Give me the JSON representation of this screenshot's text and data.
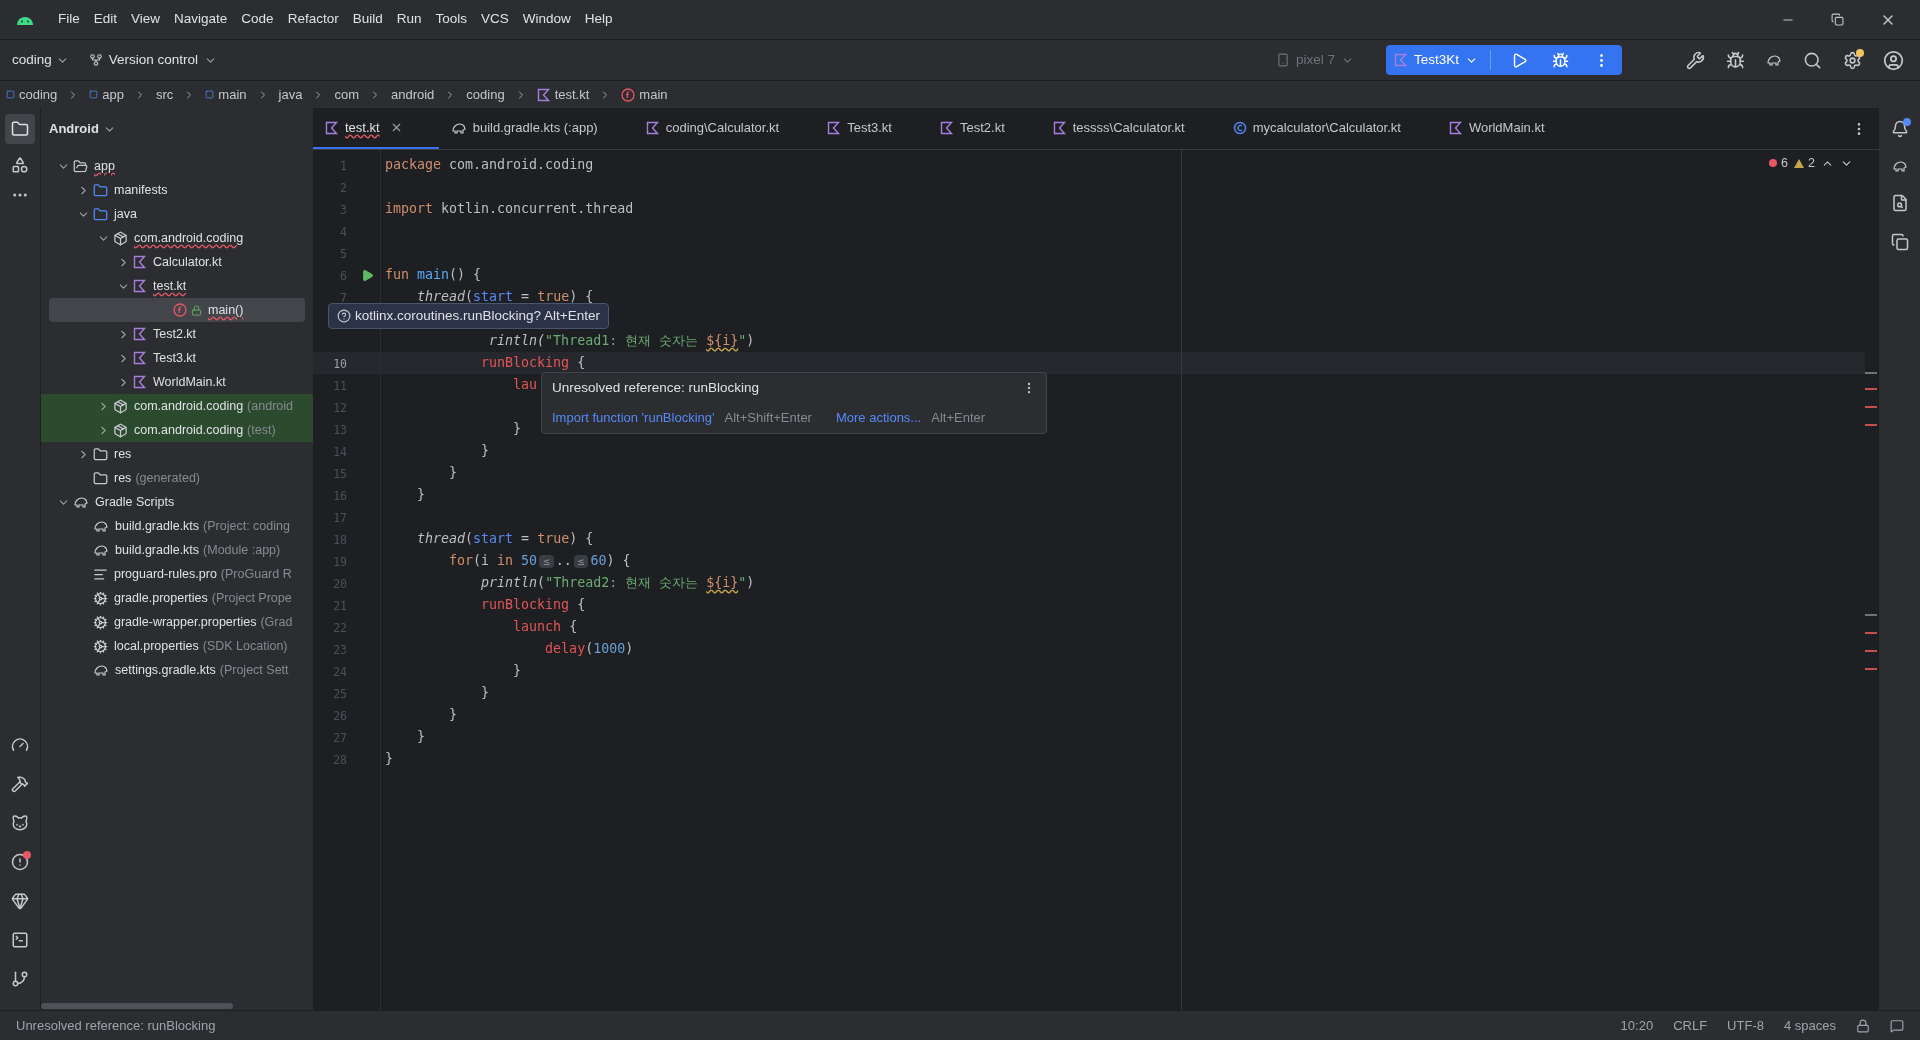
{
  "menu": [
    "File",
    "Edit",
    "View",
    "Navigate",
    "Code",
    "Refactor",
    "Build",
    "Run",
    "Tools",
    "VCS",
    "Window",
    "Help"
  ],
  "toolbar": {
    "project": "coding",
    "vcs": "Version control",
    "device": "pixel 7",
    "run_config": "Test3Kt"
  },
  "breadcrumbs": [
    {
      "label": "coding",
      "kind": "module"
    },
    {
      "label": "app",
      "kind": "module"
    },
    {
      "label": "src",
      "kind": "plain"
    },
    {
      "label": "main",
      "kind": "module"
    },
    {
      "label": "java",
      "kind": "plain"
    },
    {
      "label": "com",
      "kind": "plain"
    },
    {
      "label": "android",
      "kind": "plain"
    },
    {
      "label": "coding",
      "kind": "plain"
    },
    {
      "label": "test.kt",
      "kind": "kotlin"
    },
    {
      "label": "main",
      "kind": "function"
    }
  ],
  "project_panel": {
    "title": "Android",
    "tree": [
      {
        "label": "app",
        "kind": "module",
        "expanded": true,
        "error": true,
        "selected": false,
        "children": [
          {
            "label": "manifests",
            "kind": "folder",
            "expanded": false,
            "error": false,
            "selected": false
          },
          {
            "label": "java",
            "kind": "folder",
            "expanded": true,
            "error": false,
            "selected": false,
            "children": [
              {
                "label": "com.android.coding",
                "kind": "package",
                "expanded": true,
                "error": true,
                "selected": false,
                "children": [
                  {
                    "label": "Calculator.kt",
                    "kind": "kotlin",
                    "expanded": false,
                    "error": false,
                    "selected": false
                  },
                  {
                    "label": "test.kt",
                    "kind": "kotlin",
                    "expanded": true,
                    "error": true,
                    "selected": false,
                    "children": [
                      {
                        "label": "main()",
                        "kind": "function",
                        "error": true,
                        "selected": true
                      }
                    ]
                  },
                  {
                    "label": "Test2.kt",
                    "kind": "kotlin",
                    "expanded": false,
                    "error": false,
                    "selected": false
                  },
                  {
                    "label": "Test3.kt",
                    "kind": "kotlin",
                    "expanded": false,
                    "error": false,
                    "selected": false
                  },
                  {
                    "label": "WorldMain.kt",
                    "kind": "kotlin",
                    "expanded": false,
                    "error": false,
                    "selected": false
                  }
                ]
              },
              {
                "label": "com.android.coding",
                "note": "(android",
                "kind": "package",
                "expanded": false,
                "error": false,
                "selected": false,
                "highlighted": true
              },
              {
                "label": "com.android.coding",
                "note": "(test)",
                "kind": "package",
                "expanded": false,
                "error": false,
                "selected": false,
                "highlighted": true
              }
            ]
          },
          {
            "label": "res",
            "kind": "res",
            "expanded": false,
            "error": false,
            "selected": false
          },
          {
            "label": "res",
            "note": "(generated)",
            "kind": "res",
            "error": false,
            "selected": false
          }
        ]
      },
      {
        "label": "Gradle Scripts",
        "kind": "gradle-root",
        "expanded": true,
        "error": false,
        "selected": false,
        "children": [
          {
            "label": "build.gradle.kts",
            "note": "(Project: coding",
            "kind": "gradle",
            "error": false,
            "selected": false
          },
          {
            "label": "build.gradle.kts",
            "note": "(Module :app)",
            "kind": "gradle",
            "error": false,
            "selected": false
          },
          {
            "label": "proguard-rules.pro",
            "note": "(ProGuard R",
            "kind": "text",
            "error": false,
            "selected": false
          },
          {
            "label": "gradle.properties",
            "note": "(Project Prope",
            "kind": "settings",
            "error": false,
            "selected": false
          },
          {
            "label": "gradle-wrapper.properties",
            "note": "(Grad",
            "kind": "settings",
            "error": false,
            "selected": false
          },
          {
            "label": "local.properties",
            "note": "(SDK Location)",
            "kind": "settings",
            "error": false,
            "selected": false
          },
          {
            "label": "settings.gradle.kts",
            "note": "(Project Sett",
            "kind": "gradle",
            "error": false,
            "selected": false
          }
        ]
      }
    ]
  },
  "tabs": [
    {
      "label": "test.kt",
      "kind": "kotlin",
      "selected": true,
      "error": true
    },
    {
      "label": "build.gradle.kts (:app)",
      "kind": "gradle",
      "selected": false,
      "error": false
    },
    {
      "label": "coding\\Calculator.kt",
      "kind": "kotlin",
      "selected": false,
      "error": false
    },
    {
      "label": "Test3.kt",
      "kind": "kotlin",
      "selected": false,
      "error": false
    },
    {
      "label": "Test2.kt",
      "kind": "kotlin",
      "selected": false,
      "error": false
    },
    {
      "label": "tessss\\Calculator.kt",
      "kind": "kotlin",
      "selected": false,
      "error": false
    },
    {
      "label": "mycalculator\\Calculator.kt",
      "kind": "class",
      "selected": false,
      "error": false
    },
    {
      "label": "WorldMain.kt",
      "kind": "kotlin",
      "selected": false,
      "error": false
    }
  ],
  "editor": {
    "problems": {
      "errors": "6",
      "warnings": "2"
    },
    "lines": [
      {
        "number": "1",
        "selected": false,
        "runnable": false,
        "tokens": [
          {
            "kind": "keyword",
            "text": "package"
          },
          {
            "kind": "plain",
            "text": " com.android.coding"
          }
        ]
      },
      {
        "number": "2",
        "selected": false,
        "runnable": false
      },
      {
        "number": "3",
        "selected": false,
        "runnable": false,
        "tokens": [
          {
            "kind": "keyword",
            "text": "import"
          },
          {
            "kind": "plain",
            "text": " kotlin.concurrent.thread"
          }
        ]
      },
      {
        "number": "4",
        "selected": false,
        "runnable": false
      },
      {
        "number": "5",
        "selected": false,
        "runnable": false
      },
      {
        "number": "6",
        "selected": false,
        "runnable": true,
        "tokens": [
          {
            "kind": "keyword",
            "text": "fun "
          },
          {
            "kind": "decl",
            "text": "main"
          },
          {
            "kind": "plain",
            "text": "() {"
          }
        ]
      },
      {
        "number": "7",
        "selected": false,
        "runnable": false,
        "tokens": [
          {
            "kind": "italic",
            "text": "    thread"
          },
          {
            "kind": "plain",
            "text": "("
          },
          {
            "kind": "named_arg",
            "text": "start"
          },
          {
            "kind": "plain",
            "text": " = "
          },
          {
            "kind": "keyword",
            "text": "true"
          },
          {
            "kind": "plain",
            "text": ") {"
          }
        ]
      },
      {
        "selected": false,
        "runnable": false
      },
      {
        "selected": false,
        "runnable": false,
        "tokens": [
          {
            "kind": "italic",
            "text": "             rintln("
          },
          {
            "kind": "string",
            "text": "\"Thread1: 현재 숫자는 "
          },
          {
            "kind": "template",
            "text": "${i}"
          },
          {
            "kind": "string",
            "text": "\""
          },
          {
            "kind": "plain",
            "text": ")"
          }
        ]
      },
      {
        "number": "10",
        "selected": true,
        "runnable": false,
        "tokens": [
          {
            "kind": "unresolved",
            "text": "            runBlocking"
          },
          {
            "kind": "plain",
            "text": " {"
          }
        ]
      },
      {
        "number": "11",
        "selected": false,
        "runnable": false,
        "tokens": [
          {
            "kind": "unresolved",
            "text": "                lau"
          }
        ]
      },
      {
        "number": "12",
        "selected": false,
        "runnable": false
      },
      {
        "number": "13",
        "selected": false,
        "runnable": false,
        "tokens": [
          {
            "kind": "plain",
            "text": "                }"
          }
        ]
      },
      {
        "number": "14",
        "selected": false,
        "runnable": false,
        "tokens": [
          {
            "kind": "plain",
            "text": "            }"
          }
        ]
      },
      {
        "number": "15",
        "selected": false,
        "runnable": false,
        "tokens": [
          {
            "kind": "plain",
            "text": "        }"
          }
        ]
      },
      {
        "number": "16",
        "selected": false,
        "runnable": false,
        "tokens": [
          {
            "kind": "plain",
            "text": "    }"
          }
        ]
      },
      {
        "number": "17",
        "selected": false,
        "runnable": false
      },
      {
        "number": "18",
        "selected": false,
        "runnable": false,
        "tokens": [
          {
            "kind": "italic",
            "text": "    thread"
          },
          {
            "kind": "plain",
            "text": "("
          },
          {
            "kind": "named_arg",
            "text": "start"
          },
          {
            "kind": "plain",
            "text": " = "
          },
          {
            "kind": "keyword",
            "text": "true"
          },
          {
            "kind": "plain",
            "text": ") {"
          }
        ]
      },
      {
        "number": "19",
        "selected": false,
        "runnable": false,
        "tokens": [
          {
            "kind": "keyword",
            "text": "        for"
          },
          {
            "kind": "plain",
            "text": "(i "
          },
          {
            "kind": "keyword",
            "text": "in"
          },
          {
            "kind": "number",
            "text": " 50"
          },
          {
            "kind": "inlay",
            "text": "≤"
          },
          {
            "kind": "plain",
            "text": ".."
          },
          {
            "kind": "inlay",
            "text": "≤"
          },
          {
            "kind": "number",
            "text": "60"
          },
          {
            "kind": "plain",
            "text": ") {"
          }
        ]
      },
      {
        "number": "20",
        "selected": false,
        "runnable": false,
        "tokens": [
          {
            "kind": "italic",
            "text": "            println"
          },
          {
            "kind": "plain",
            "text": "("
          },
          {
            "kind": "string",
            "text": "\"Thread2: 현재 숫자는 "
          },
          {
            "kind": "template",
            "text": "${i}"
          },
          {
            "kind": "string",
            "text": "\""
          },
          {
            "kind": "plain",
            "text": ")"
          }
        ]
      },
      {
        "number": "21",
        "selected": false,
        "runnable": false,
        "tokens": [
          {
            "kind": "unresolved",
            "text": "            runBlocking"
          },
          {
            "kind": "plain",
            "text": " {"
          }
        ]
      },
      {
        "number": "22",
        "selected": false,
        "runnable": false,
        "tokens": [
          {
            "kind": "unresolved",
            "text": "                launch"
          },
          {
            "kind": "plain",
            "text": " {"
          }
        ]
      },
      {
        "number": "23",
        "selected": false,
        "runnable": false,
        "tokens": [
          {
            "kind": "unresolved",
            "text": "                    delay"
          },
          {
            "kind": "plain",
            "text": "("
          },
          {
            "kind": "number",
            "text": "1000"
          },
          {
            "kind": "plain",
            "text": ")"
          }
        ]
      },
      {
        "number": "24",
        "selected": false,
        "runnable": false,
        "tokens": [
          {
            "kind": "plain",
            "text": "                }"
          }
        ]
      },
      {
        "number": "25",
        "selected": false,
        "runnable": false,
        "tokens": [
          {
            "kind": "plain",
            "text": "            }"
          }
        ]
      },
      {
        "number": "26",
        "selected": false,
        "runnable": false,
        "tokens": [
          {
            "kind": "plain",
            "text": "        }"
          }
        ]
      },
      {
        "number": "27",
        "selected": false,
        "runnable": false,
        "tokens": [
          {
            "kind": "plain",
            "text": "    }"
          }
        ]
      },
      {
        "number": "28",
        "selected": false,
        "runnable": false,
        "tokens": [
          {
            "kind": "plain",
            "text": "}"
          }
        ]
      }
    ],
    "hint_tooltip": {
      "text": "kotlinx.coroutines.runBlocking? Alt+Enter"
    },
    "error_popup": {
      "message": "Unresolved reference: runBlocking",
      "actions": [
        {
          "label": "Import function 'runBlocking'",
          "shortcut": "Alt+Shift+Enter"
        },
        {
          "label": "More actions...",
          "shortcut": "Alt+Enter"
        }
      ]
    }
  },
  "status_bar": {
    "message": "Unresolved reference: runBlocking",
    "items": [
      "10:20",
      "CRLF",
      "UTF-8",
      "4 spaces"
    ]
  }
}
